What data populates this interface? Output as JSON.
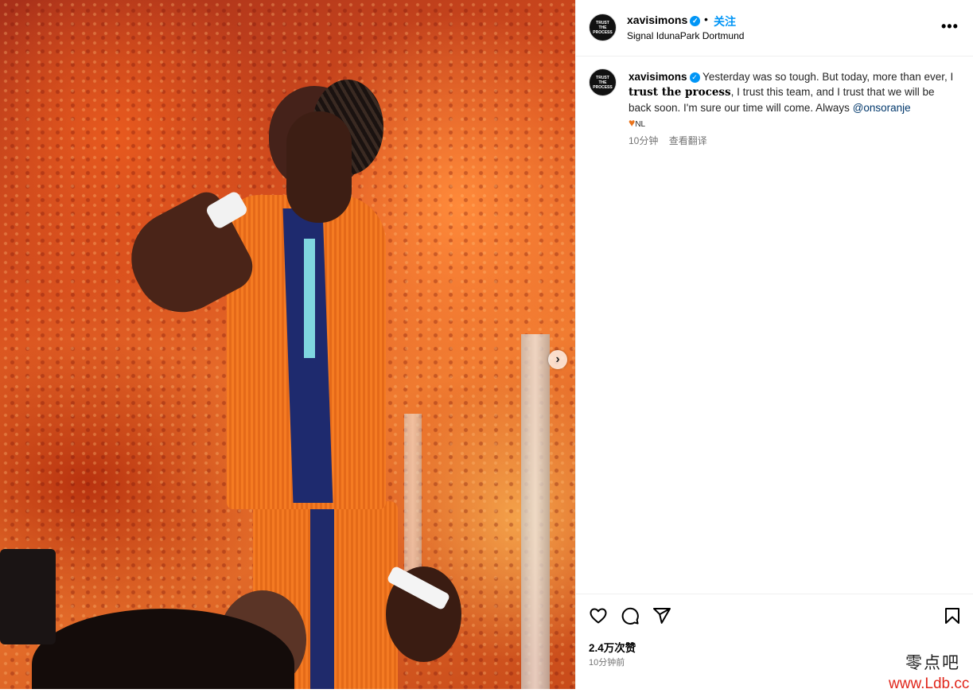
{
  "post": {
    "username": "xavisimons",
    "verified_mark": "✓",
    "separator": "•",
    "follow_label": "关注",
    "location": "Signal IdunaPark Dortmund",
    "more_label": "•••",
    "avatar_lines": [
      "TRUST",
      "THE",
      "PROCESS"
    ]
  },
  "caption": {
    "username": "xavisimons",
    "text_before": " Yesterday was so tough. But today, more than ever, I ",
    "bold_text": "trust the process",
    "text_after": ", I trust this team, and I trust that we will be back soon. I'm sure our time will come. Always ",
    "mention": "@onsoranje",
    "emoji": "♥",
    "flag_text": "NL",
    "time_ago": "10分钟",
    "translate_label": "查看翻译"
  },
  "actions": {
    "likes": "2.4万次赞",
    "posted_ago": "10分钟前"
  },
  "carousel": {
    "next_glyph": "›"
  },
  "watermark": {
    "line1": "零点吧",
    "line2": "www.Ldb.cc"
  },
  "colors": {
    "accent": "#0095f6",
    "mention": "#00376b",
    "watermark_red": "#e0261b",
    "jersey_orange": "#f47a22"
  },
  "icons": [
    "heart-icon",
    "comment-icon",
    "share-icon",
    "bookmark-icon",
    "verified-icon",
    "more-icon",
    "chevron-right-icon"
  ]
}
